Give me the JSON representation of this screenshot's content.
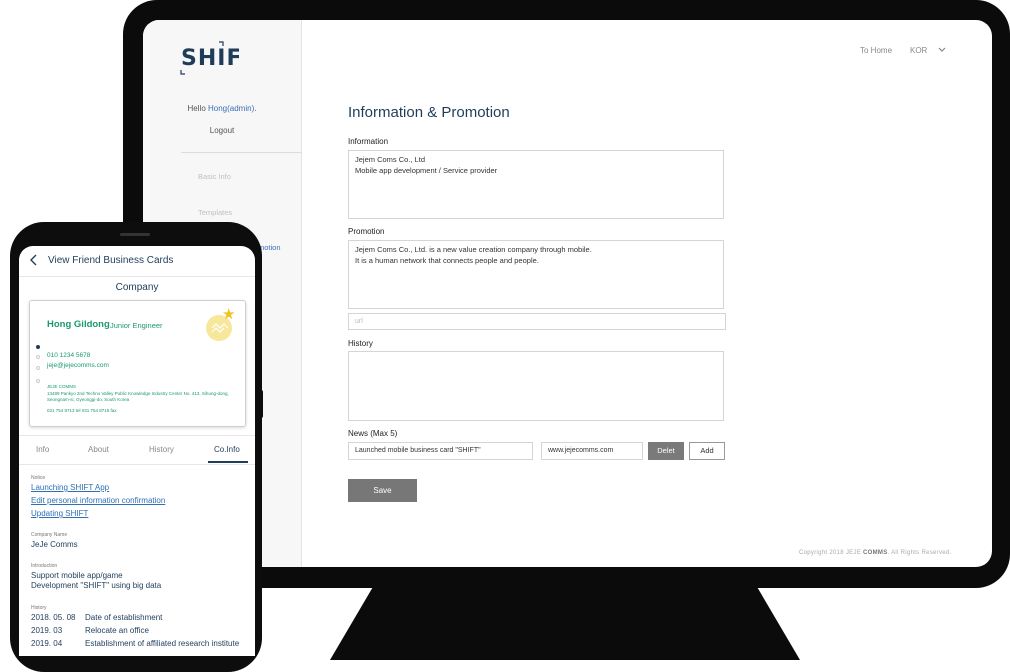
{
  "desktop": {
    "logo": "SHIFT",
    "greeting_prefix": "Hello ",
    "user": "Hong(admin)",
    "greeting_suffix": ".",
    "logout": "Logout",
    "nav": {
      "basic_info": "Basic Info",
      "templates": "Templates",
      "active_partial": "motion"
    },
    "topnav": {
      "home": "To Home",
      "language": "KOR"
    },
    "page_title": "Information & Promotion",
    "information": {
      "label": "Information",
      "line1": "Jejem Coms Co., Ltd",
      "line2": "Mobile app development / Service provider"
    },
    "promotion": {
      "label": "Promotion",
      "line1": "Jejem Coms Co., Ltd. is a new value creation company through mobile.",
      "line2": "It is a human network that connects people and people.",
      "url_placeholder": "url"
    },
    "history": {
      "label": "History",
      "value": ""
    },
    "news": {
      "label": "News (Max 5)",
      "title_value": "Launched mobile business card \"SHIFT\"",
      "url_value": "www.jejecomms.com",
      "delete_label": "Delet",
      "add_label": "Add"
    },
    "save_label": "Save",
    "copyright_prefix": "Copyright 2018 JEJE ",
    "copyright_brand": "COMMS",
    "copyright_suffix": ". All Rights Reserved."
  },
  "mobile": {
    "header_title": "View Friend Business Cards",
    "section_title": "Company",
    "card": {
      "name": "Hong Gildong",
      "role": "Junior Engineer",
      "phone": "010 1234 5678",
      "email": "jeje@jejecomms.com",
      "company": "JEJE COMMS",
      "address": "13489 Pankyo 2nd Techno Valley Public Knowledge Industry Center No. 413, Sihung-dong, Seongnam-si, Gyeonggi-do, South Korea",
      "tel_fax": "031 754 8713 tel  031 754 8715 fax"
    },
    "tabs": [
      "Info",
      "About",
      "History",
      "Co.Info"
    ],
    "notice_label": "Notice",
    "notices": [
      "Launching SHIFT App",
      "Edit personal information confirmation",
      "Updating SHIFT"
    ],
    "company_name_label": "Company Name",
    "company_name": "JeJe Comms",
    "introduction_label": "Introduction",
    "introduction_line1": "Support mobile app/game",
    "introduction_line2": "Development \"SHIFT\" using big data",
    "history_label": "History",
    "history": [
      {
        "date": "2018. 05. 08",
        "event": "Date of establishment"
      },
      {
        "date": "2019. 03",
        "event": "Relocate an office"
      },
      {
        "date": "2019. 04",
        "event": "Establishment of affiliated research institute"
      }
    ]
  },
  "colors": {
    "navy": "#1f3d5b",
    "green": "#1a9a6c",
    "link": "#2f6fb5",
    "button_gray": "#777777"
  }
}
